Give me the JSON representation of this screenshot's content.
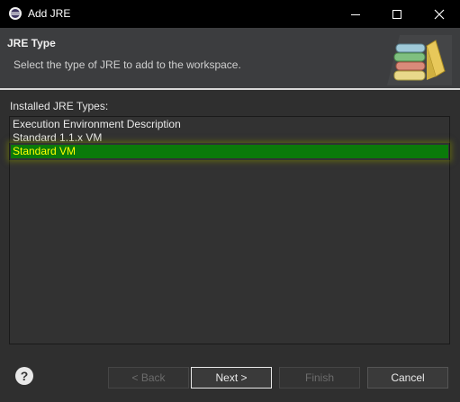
{
  "window": {
    "title": "Add JRE",
    "app_icon": "eclipse-icon",
    "controls": {
      "minimize": "—",
      "maximize": "☐",
      "close": "✕"
    }
  },
  "header": {
    "title": "JRE Type",
    "description": "Select the type of JRE to add to the workspace.",
    "icon": "library-books-icon"
  },
  "main": {
    "list_label": "Installed JRE Types:",
    "items": [
      {
        "label": "Execution Environment Description",
        "selected": false
      },
      {
        "label": "Standard 1.1.x VM",
        "selected": false
      },
      {
        "label": "Standard VM",
        "selected": true
      }
    ]
  },
  "footer": {
    "help": "?",
    "back": "< Back",
    "next": "Next >",
    "finish": "Finish",
    "cancel": "Cancel"
  },
  "colors": {
    "selection_bg": "#0a7a0a",
    "selection_text": "#ffff00"
  }
}
